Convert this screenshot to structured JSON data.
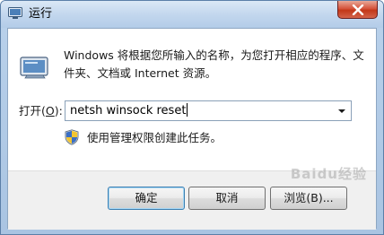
{
  "window": {
    "title": "运行"
  },
  "dialog": {
    "description": "Windows 将根据您所输入的名称，为您打开相应的程序、文件夹、文档或 Internet 资源。",
    "open_label_prefix": "打开(",
    "open_label_accel": "O",
    "open_label_suffix": "):",
    "command_value": "netsh winsock reset",
    "admin_note": "使用管理权限创建此任务。"
  },
  "buttons": {
    "ok_label": "确定",
    "cancel_label": "取消",
    "browse_label": "浏览(B)..."
  },
  "watermark": {
    "text": "Baidu经验"
  },
  "icons": {
    "title_icon": "run-icon",
    "app_icon": "run-app-icon",
    "shield": "uac-shield-icon",
    "close": "close-icon",
    "dropdown": "chevron-down-icon"
  },
  "colors": {
    "title_bar": "#c3d7ee",
    "close_button": "#c23718",
    "default_button_border": "#3c7fb1",
    "footer_bg": "#f0f0f0"
  }
}
